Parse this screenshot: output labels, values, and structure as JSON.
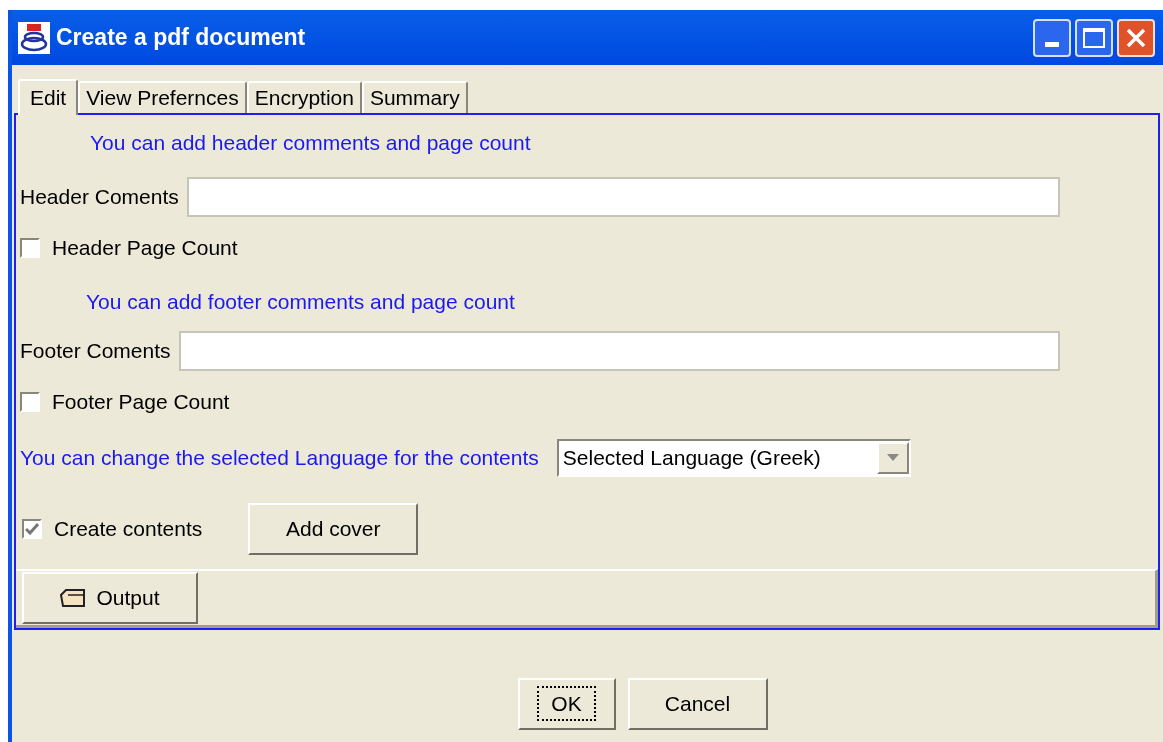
{
  "window": {
    "title": "Create a pdf document"
  },
  "tabs": [
    {
      "label": "Edit",
      "selected": true
    },
    {
      "label": "View Prefernces",
      "selected": false
    },
    {
      "label": "Encryption",
      "selected": false
    },
    {
      "label": "Summary",
      "selected": false
    }
  ],
  "items": [
    {
      "kind": "heading",
      "text": "You can add header comments and page count"
    },
    {
      "kind": "field",
      "label": "Header Coments"
    },
    {
      "kind": "checkbox",
      "label": "Header Page Count",
      "checked": false
    },
    {
      "kind": "heading",
      "text": "You can add footer comments and page count"
    },
    {
      "kind": "field",
      "label": "Footer Coments"
    },
    {
      "kind": "checkbox",
      "label": "Footer Page Count",
      "checked": false
    },
    {
      "kind": "select",
      "label": "You can change the selected Language for the contents",
      "value": "Selected Language (Greek)"
    },
    {
      "kind": "checkbox_button",
      "label": "Create contents",
      "checked": true,
      "button": "Add cover"
    }
  ],
  "output_button": "Output",
  "buttons": [
    "OK",
    "Cancel"
  ]
}
